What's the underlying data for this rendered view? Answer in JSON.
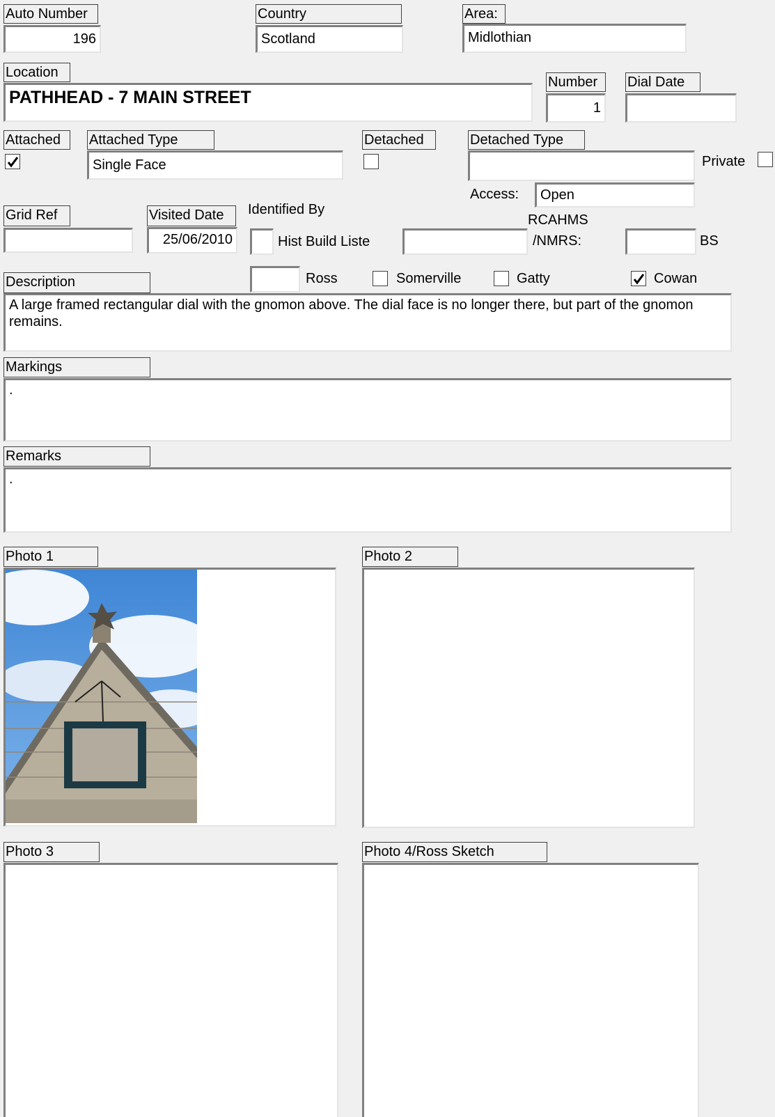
{
  "auto_number": {
    "label": "Auto Number",
    "value": "196"
  },
  "country": {
    "label": "Country",
    "value": "Scotland"
  },
  "area": {
    "label": "Area:",
    "value": "Midlothian"
  },
  "location": {
    "label": "Location",
    "value": "PATHHEAD - 7 MAIN STREET"
  },
  "number": {
    "label": "Number",
    "value": "1"
  },
  "dial_date": {
    "label": "Dial Date",
    "value": ""
  },
  "attached": {
    "label": "Attached",
    "checked": true
  },
  "attached_type": {
    "label": "Attached Type",
    "value": "Single Face"
  },
  "detached": {
    "label": "Detached",
    "checked": false
  },
  "detached_type": {
    "label": "Detached Type",
    "value": ""
  },
  "private": {
    "label": "Private",
    "checked": false
  },
  "access": {
    "label": "Access:",
    "value": "Open"
  },
  "grid_ref": {
    "label": "Grid Ref",
    "value": ""
  },
  "visited_date": {
    "label": "Visited Date",
    "value": "25/06/2010"
  },
  "identified_by": {
    "label": "Identified By",
    "hist_build_label": "Hist Build Liste",
    "hist_build_value": "",
    "ross_label": "Ross",
    "ross_value": "",
    "somerville_label": "Somerville",
    "somerville_checked": false,
    "gatty_label": "Gatty",
    "gatty_checked": false,
    "cowan_label": "Cowan",
    "cowan_checked": true
  },
  "rcahms": {
    "label_line1": "RCAHMS",
    "label_line2": "/NMRS:",
    "value": ""
  },
  "bs": {
    "label": "BS",
    "value": ""
  },
  "description": {
    "label": "Description",
    "value": "A large framed rectangular dial with the gnomon above.  The dial face is no longer there, but part of the gnomon remains."
  },
  "markings": {
    "label": "Markings",
    "value": "."
  },
  "remarks": {
    "label": "Remarks",
    "value": "."
  },
  "photos": {
    "photo1_label": "Photo 1",
    "photo2_label": "Photo 2",
    "photo3_label": "Photo 3",
    "photo4_label": "Photo 4/Ross Sketch"
  },
  "colors": {
    "background": "#f0f0f0",
    "field": "#ffffff",
    "sky": "#4a8fd8",
    "stone": "#b4aa98",
    "dial_frame": "#1c3a44"
  }
}
